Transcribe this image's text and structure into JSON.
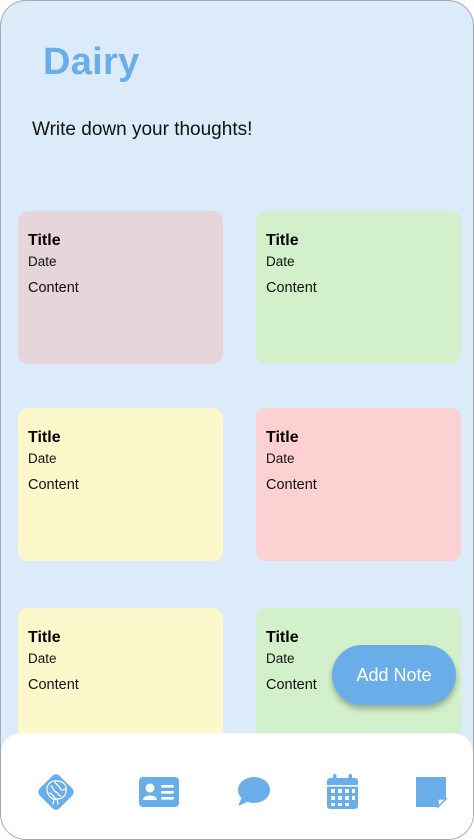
{
  "app": {
    "title": "Dairy",
    "subtitle": "Write down your thoughts!"
  },
  "notes": [
    {
      "title": "Title",
      "date": "Date",
      "content": "Content",
      "color": "#e7d5dc"
    },
    {
      "title": "Title",
      "date": "Date",
      "content": "Content",
      "color": "#d2f0ca"
    },
    {
      "title": "Title",
      "date": "Date",
      "content": "Content",
      "color": "#fdf8cc"
    },
    {
      "title": "Title",
      "date": "Date",
      "content": "Content",
      "color": "#fdd1d2"
    },
    {
      "title": "Title",
      "date": "Date",
      "content": "Content",
      "color": "#fdf8cc"
    },
    {
      "title": "Title",
      "date": "Date",
      "content": "Content",
      "color": "#d2f0ca"
    }
  ],
  "fab": {
    "label": "Add Note",
    "color": "#6aaee9"
  },
  "bottom_nav": {
    "items": [
      {
        "icon": "brain-logo-icon"
      },
      {
        "icon": "contact-card-icon"
      },
      {
        "icon": "chat-bubble-icon"
      },
      {
        "icon": "calendar-icon"
      },
      {
        "icon": "sticky-note-icon"
      }
    ],
    "icon_color": "#6aaee9"
  },
  "theme": {
    "background": "#dbebfa",
    "accent": "#6aaee9"
  }
}
